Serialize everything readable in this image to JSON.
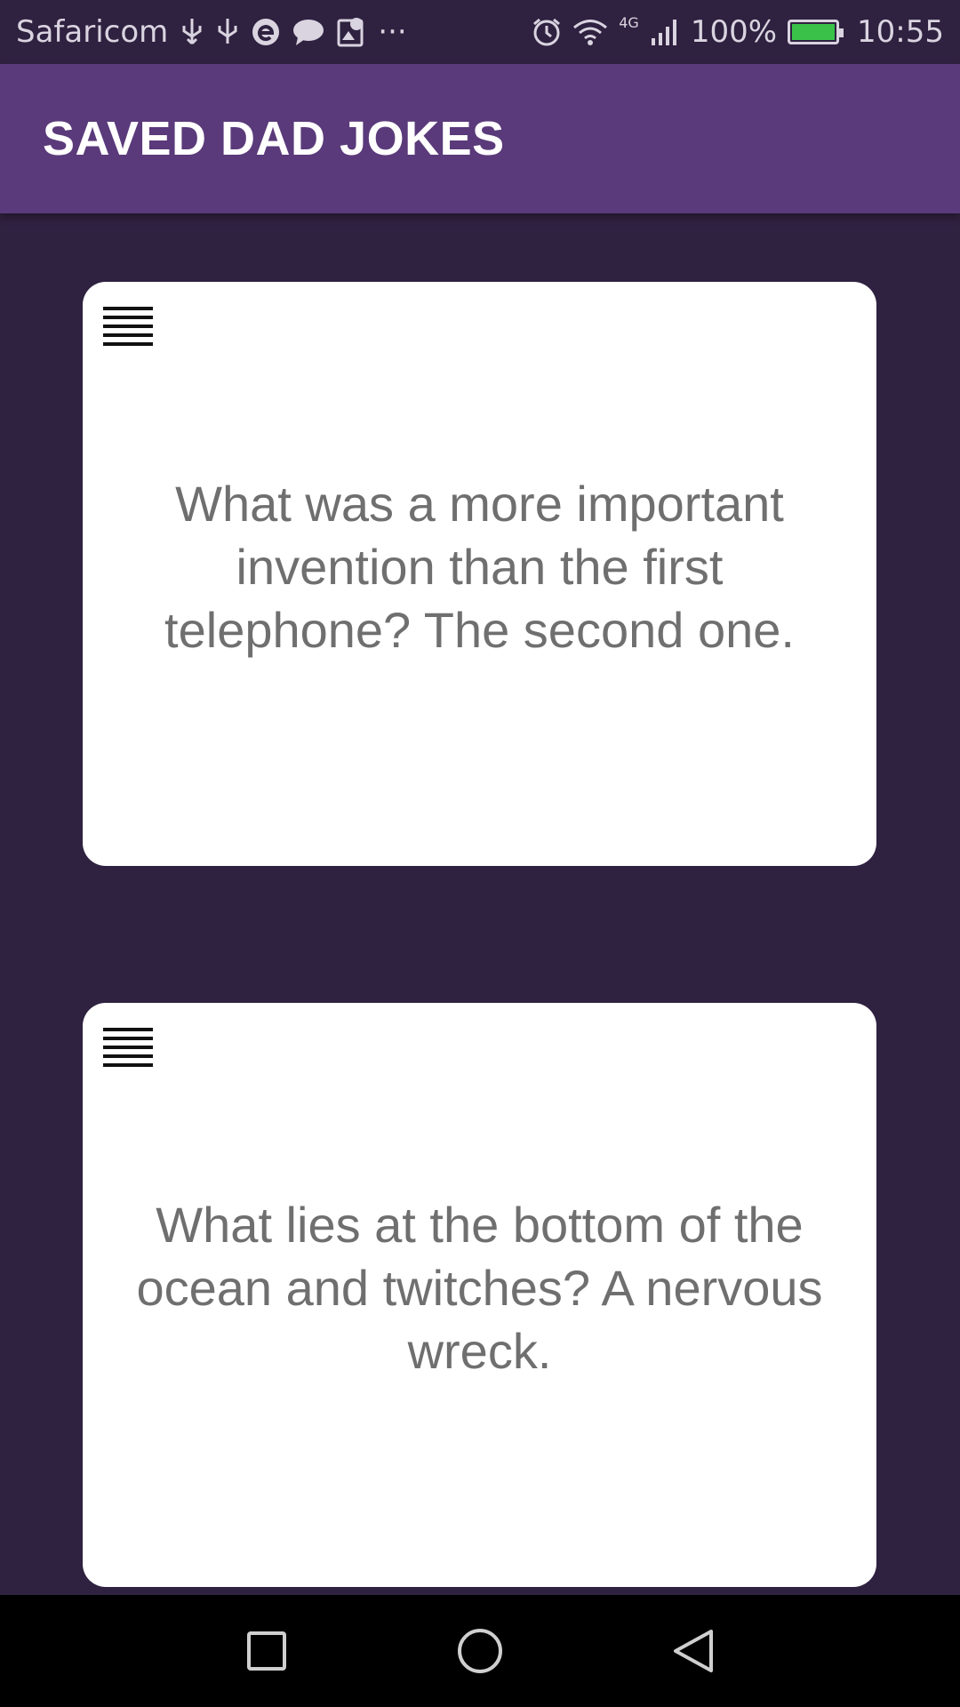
{
  "status_bar": {
    "carrier": "Safaricom",
    "network": "4G",
    "battery": "100%",
    "time": "10:55",
    "icons": [
      "usb-icon",
      "usb-icon",
      "browser-icon",
      "chat-icon",
      "gallery-icon",
      "more-icon",
      "alarm-icon",
      "wifi-icon",
      "signal-icon",
      "battery-icon"
    ],
    "battery_color": "#39c24a"
  },
  "app_bar": {
    "title": "SAVED DAD JOKES",
    "color": "#5a3a7a"
  },
  "jokes": [
    {
      "text": "What was a more important invention than the first telephone? The second one."
    },
    {
      "text": "What lies at the bottom of the ocean and twitches? A nervous wreck."
    }
  ],
  "nav_bar": {
    "buttons": [
      "recent-apps-icon",
      "home-icon",
      "back-icon"
    ]
  },
  "colors": {
    "background": "#2f2140",
    "card": "#ffffff",
    "joke_text": "#6f6f6f"
  }
}
